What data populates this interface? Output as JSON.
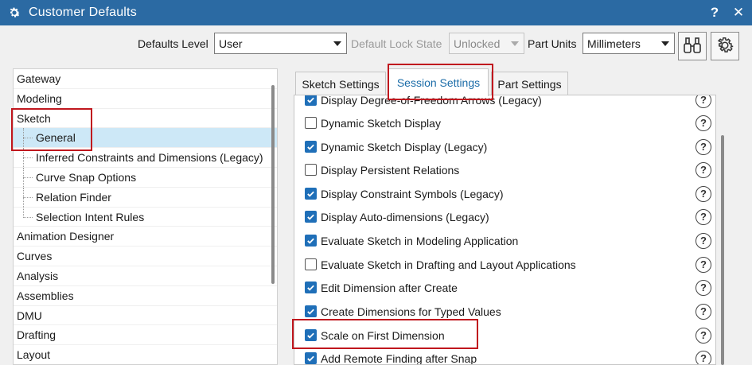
{
  "window": {
    "title": "Customer Defaults",
    "help_label": "?",
    "close_label": "✕"
  },
  "toolbar": {
    "defaults_level_label": "Defaults Level",
    "defaults_level_value": "User",
    "lock_state_label": "Default Lock State",
    "lock_state_value": "Unlocked",
    "part_units_label": "Part Units",
    "part_units_value": "Millimeters"
  },
  "tree": {
    "items": [
      {
        "label": "Gateway"
      },
      {
        "label": "Modeling"
      },
      {
        "label": "Sketch"
      },
      {
        "label": "General",
        "selected": true
      },
      {
        "label": "Inferred Constraints and Dimensions (Legacy)"
      },
      {
        "label": "Curve Snap Options"
      },
      {
        "label": "Relation Finder"
      },
      {
        "label": "Selection Intent Rules"
      },
      {
        "label": "Animation Designer"
      },
      {
        "label": "Curves"
      },
      {
        "label": "Analysis"
      },
      {
        "label": "Assemblies"
      },
      {
        "label": "DMU"
      },
      {
        "label": "Drafting"
      },
      {
        "label": "Layout"
      }
    ]
  },
  "tabs": [
    {
      "label": "Sketch Settings"
    },
    {
      "label": "Session Settings",
      "active": true
    },
    {
      "label": "Part Settings"
    }
  ],
  "settings": [
    {
      "label": "Display Degree-of-Freedom Arrows (Legacy)",
      "checked": true
    },
    {
      "label": "Dynamic Sketch Display",
      "checked": false
    },
    {
      "label": "Dynamic Sketch Display (Legacy)",
      "checked": true
    },
    {
      "label": "Display Persistent Relations",
      "checked": false
    },
    {
      "label": "Display Constraint Symbols (Legacy)",
      "checked": true
    },
    {
      "label": "Display Auto-dimensions (Legacy)",
      "checked": true
    },
    {
      "label": "Evaluate Sketch in Modeling Application",
      "checked": true
    },
    {
      "label": "Evaluate Sketch in Drafting and Layout Applications",
      "checked": false
    },
    {
      "label": "Edit Dimension after Create",
      "checked": true
    },
    {
      "label": "Create Dimensions for Typed Values",
      "checked": true
    },
    {
      "label": "Scale on First Dimension",
      "checked": true
    },
    {
      "label": "Add Remote Finding after Snap",
      "checked": true
    }
  ],
  "help_glyph": "?",
  "colors": {
    "titlebar": "#2b6aa3",
    "accent": "#1f6fb8",
    "highlight": "#c0171e",
    "selection": "#cde8f7"
  }
}
